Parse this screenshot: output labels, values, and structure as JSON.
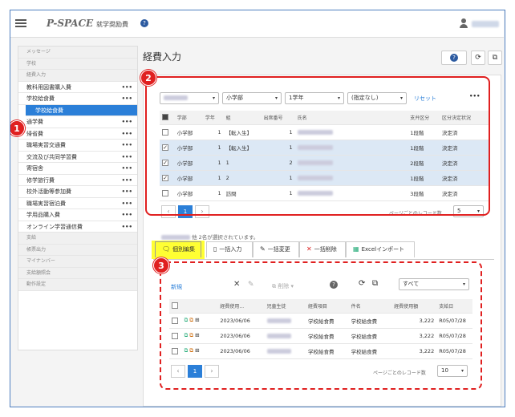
{
  "header": {
    "logo": "P-SPACE",
    "app_title": "就学奨励費",
    "help": "?"
  },
  "page": {
    "title": "経費入力"
  },
  "toolbar": {
    "help": "?",
    "refresh": "⟳",
    "popout": "⧉"
  },
  "sidebar": [
    {
      "label": "メッセージ",
      "type": "hdr"
    },
    {
      "label": "学校",
      "type": "hdr"
    },
    {
      "label": "経費入力",
      "type": "hdr"
    },
    {
      "label": "教科用図書購入費",
      "type": "item",
      "menu": "•••"
    },
    {
      "label": "学校給食費",
      "type": "item",
      "menu": "•••"
    },
    {
      "label": "学校給食費",
      "type": "active"
    },
    {
      "label": "通学費",
      "type": "item",
      "menu": "•••"
    },
    {
      "label": "帰省費",
      "type": "item",
      "menu": "•••"
    },
    {
      "label": "職場実習交通費",
      "type": "item",
      "menu": "•••"
    },
    {
      "label": "交流及び共同学習費",
      "type": "item",
      "menu": "•••"
    },
    {
      "label": "寄宿舎",
      "type": "item",
      "menu": "•••"
    },
    {
      "label": "修学旅行費",
      "type": "item",
      "menu": "•••"
    },
    {
      "label": "校外活動等参加費",
      "type": "item",
      "menu": "•••"
    },
    {
      "label": "職場実習宿泊費",
      "type": "item",
      "menu": "•••"
    },
    {
      "label": "学用品購入費",
      "type": "item",
      "menu": "•••"
    },
    {
      "label": "オンライン学習通信費",
      "type": "item",
      "menu": "•••"
    },
    {
      "label": "支給",
      "type": "hdr"
    },
    {
      "label": "帳票出力",
      "type": "hdr"
    },
    {
      "label": "マイナンバー",
      "type": "hdr"
    },
    {
      "label": "支給額照会",
      "type": "hdr"
    },
    {
      "label": "動作設定",
      "type": "hdr"
    }
  ],
  "badges": [
    "1",
    "2",
    "3"
  ],
  "filters": {
    "f2": "小学部",
    "f3": "1学年",
    "f4": "(指定なし)",
    "reset": "リセット",
    "more": "•••"
  },
  "students": {
    "columns": [
      "学部",
      "学年",
      "組",
      "出席番号",
      "氏名",
      "支弁区分",
      "区分決定状況"
    ],
    "rows": [
      {
        "checked": false,
        "hl": false,
        "dept": "小学部",
        "grade": "1",
        "cls": "【転入生】",
        "no": "1",
        "band": "1段階",
        "status": "決定済"
      },
      {
        "checked": true,
        "hl": true,
        "dept": "小学部",
        "grade": "1",
        "cls": "【転入生】",
        "no": "1",
        "band": "1段階",
        "status": "決定済"
      },
      {
        "checked": true,
        "hl": true,
        "dept": "小学部",
        "grade": "1",
        "cls": "1",
        "no": "2",
        "band": "2段階",
        "status": "決定済"
      },
      {
        "checked": true,
        "hl": true,
        "dept": "小学部",
        "grade": "1",
        "cls": "2",
        "no": "1",
        "band": "1段階",
        "status": "決定済"
      },
      {
        "checked": false,
        "hl": false,
        "dept": "小学部",
        "grade": "1",
        "cls": "訪問",
        "no": "1",
        "band": "3段階",
        "status": "決定済"
      }
    ],
    "page": "1",
    "per_page_label": "ページごとのレコード数",
    "per_page": "5"
  },
  "selection_text": "他 2名が選択されています。",
  "tabs": [
    "個別編集",
    "一括入力",
    "一括変更",
    "一括削除",
    "Excelインポート"
  ],
  "expenses": {
    "new": "新規",
    "delete_label": "削除",
    "filter": "すべて",
    "columns": [
      "経費使用...",
      "児童生徒",
      "経費項目",
      "件名",
      "経費使用額",
      "支給日"
    ],
    "rows": [
      {
        "date": "2023/06/06",
        "item": "学校給食費",
        "subject": "学校給食費",
        "amount": "3,222",
        "paid": "R05/07/28"
      },
      {
        "date": "2023/06/06",
        "item": "学校給食費",
        "subject": "学校給食費",
        "amount": "3,222",
        "paid": "R05/07/28"
      },
      {
        "date": "2023/06/06",
        "item": "学校給食費",
        "subject": "学校給食費",
        "amount": "3,222",
        "paid": "R05/07/28"
      }
    ],
    "page": "1",
    "per_page_label": "ページごとのレコード数",
    "per_page": "10"
  }
}
